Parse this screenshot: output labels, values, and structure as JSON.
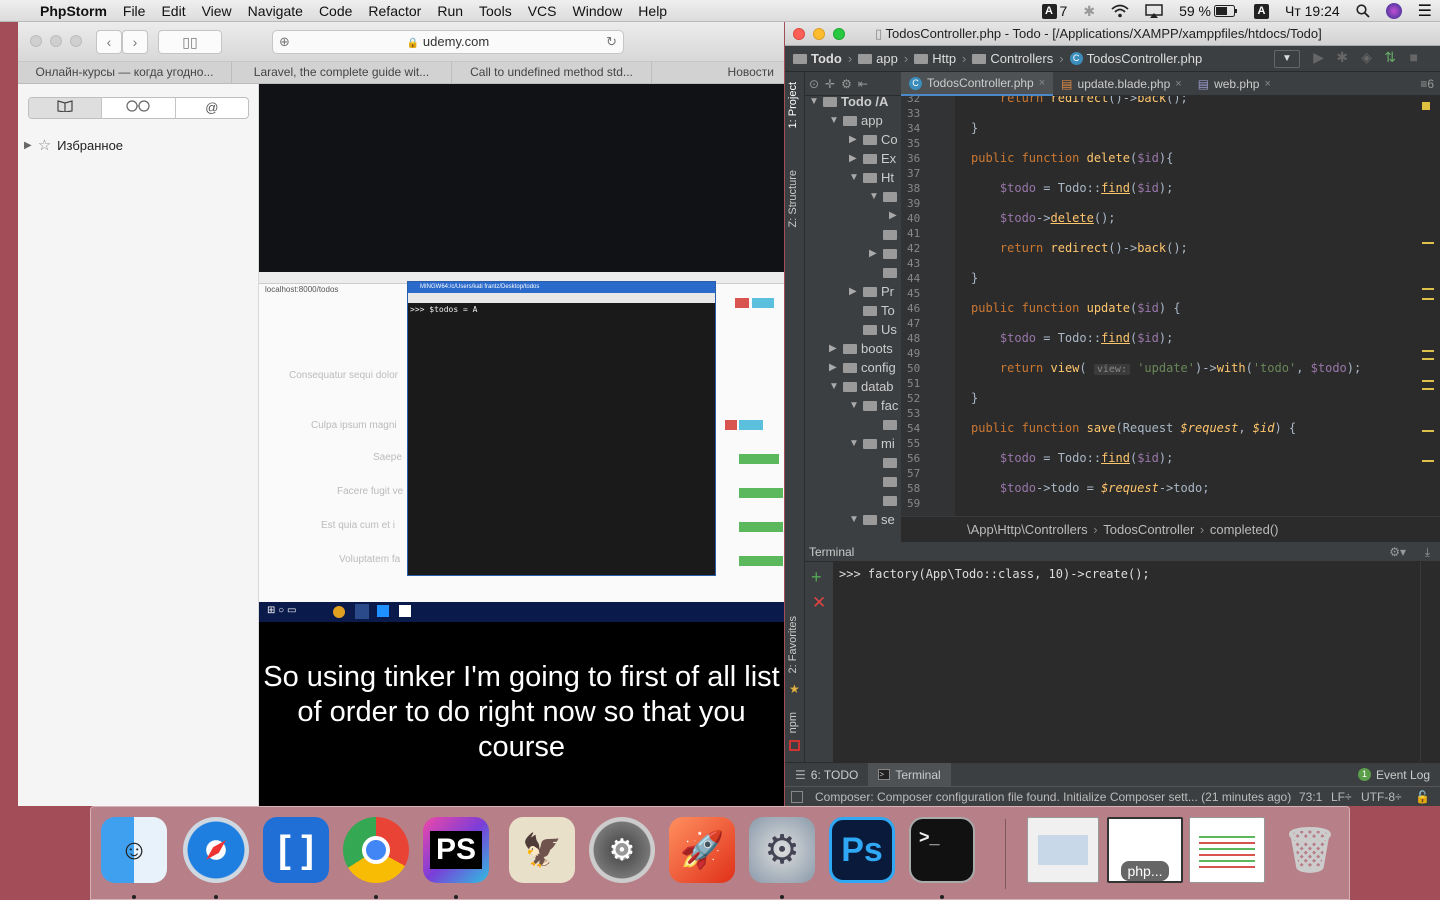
{
  "menubar": {
    "app_name": "PhpStorm",
    "items": [
      "File",
      "Edit",
      "View",
      "Navigate",
      "Code",
      "Refactor",
      "Run",
      "Tools",
      "VCS",
      "Window",
      "Help"
    ],
    "adjust_count": "7",
    "battery": "59 %",
    "input_source": "A",
    "clock": "Чт 19:24"
  },
  "safari": {
    "url": "udemy.com",
    "tabs": [
      "Онлайн-курсы — когда угодно...",
      "Laravel, the complete guide wit...",
      "Call to undefined method std...",
      "Новости"
    ],
    "sidebar": {
      "segments": [
        "📖",
        "◯◯",
        "@"
      ],
      "favorites_label": "Избранное"
    },
    "video": {
      "terminal_title": "MINGW64:/c/Users/kati frantz/Desktop/todos",
      "terminal_prompt": ">>> $todos = A",
      "browser_url": "localhost:8000/todos",
      "rows": [
        "Consequatur sequi dolor",
        "Culpa ipsum magni",
        "Saepe",
        "Facere fugit ve",
        "Est quia cum et i",
        "Voluptatem fa"
      ],
      "caption": "So using tinker I'm going to first of all list of order to do right now so that you course"
    }
  },
  "phpstorm": {
    "title": "TodosController.php - Todo - [/Applications/XAMPP/xamppfiles/htdocs/Todo]",
    "breadcrumb": [
      "Todo",
      "app",
      "Http",
      "Controllers",
      "TodosController.php"
    ],
    "left_tabs": {
      "project": "1: Project",
      "structure": "Z: Structure",
      "favorites": "2: Favorites",
      "npm": "npm"
    },
    "project_tree": [
      {
        "label": "Todo /A",
        "level": 0,
        "arrow": "▼"
      },
      {
        "label": "app",
        "level": 1,
        "arrow": "▼"
      },
      {
        "label": "Co",
        "level": 2,
        "arrow": "▶"
      },
      {
        "label": "Ex",
        "level": 2,
        "arrow": "▶"
      },
      {
        "label": "Ht",
        "level": 2,
        "arrow": "▼"
      },
      {
        "label": "",
        "level": 3,
        "arrow": "▼"
      },
      {
        "label": "",
        "level": 4,
        "arrow": "▶"
      },
      {
        "label": "",
        "level": 3,
        "arrow": ""
      },
      {
        "label": "",
        "level": 3,
        "arrow": "▶"
      },
      {
        "label": "",
        "level": 3,
        "arrow": ""
      },
      {
        "label": "Pr",
        "level": 2,
        "arrow": "▶"
      },
      {
        "label": "To",
        "level": 2,
        "arrow": ""
      },
      {
        "label": "Us",
        "level": 2,
        "arrow": ""
      },
      {
        "label": "boots",
        "level": 1,
        "arrow": "▶"
      },
      {
        "label": "config",
        "level": 1,
        "arrow": "▶"
      },
      {
        "label": "datab",
        "level": 1,
        "arrow": "▼"
      },
      {
        "label": "fac",
        "level": 2,
        "arrow": "▼"
      },
      {
        "label": "",
        "level": 3,
        "arrow": ""
      },
      {
        "label": "mi",
        "level": 2,
        "arrow": "▼"
      },
      {
        "label": "",
        "level": 3,
        "arrow": ""
      },
      {
        "label": "",
        "level": 3,
        "arrow": ""
      },
      {
        "label": "",
        "level": 3,
        "arrow": ""
      },
      {
        "label": "se",
        "level": 2,
        "arrow": "▼"
      }
    ],
    "editor_tabs": [
      "TodosController.php",
      "update.blade.php",
      "web.php"
    ],
    "line_numbers": [
      "32",
      "33",
      "34",
      "35",
      "36",
      "37",
      "38",
      "39",
      "40",
      "41",
      "42",
      "43",
      "44",
      "45",
      "46",
      "47",
      "48",
      "49",
      "50",
      "51",
      "52",
      "53",
      "54",
      "55",
      "56",
      "57",
      "58",
      "59"
    ],
    "code_breadcrumb": [
      "\\App\\Http\\Controllers",
      "TodosController",
      "completed()"
    ],
    "terminal": {
      "header": "Terminal",
      "command": ">>> factory(App\\Todo::class, 10)->create();"
    },
    "bottom_tabs": [
      "6: TODO",
      "Terminal"
    ],
    "event_log": "Event Log",
    "status": {
      "message": "Composer: Composer configuration file found. Initialize Composer sett... (21 minutes ago)",
      "position": "73:1",
      "line_sep": "LF÷",
      "encoding": "UTF-8÷"
    }
  },
  "dock": {
    "items": [
      "finder",
      "safari",
      "brackets",
      "chrome",
      "phpstorm",
      "mail",
      "system-preferences",
      "rocket",
      "settings",
      "photoshop",
      "terminal"
    ],
    "minimized_label": "php..."
  },
  "colors": {
    "desktop": "#a24d57",
    "ide_bg": "#2b2b2b",
    "keyword": "#cc7832",
    "function": "#ffc66d",
    "variable": "#9876aa",
    "string": "#6a8759"
  }
}
